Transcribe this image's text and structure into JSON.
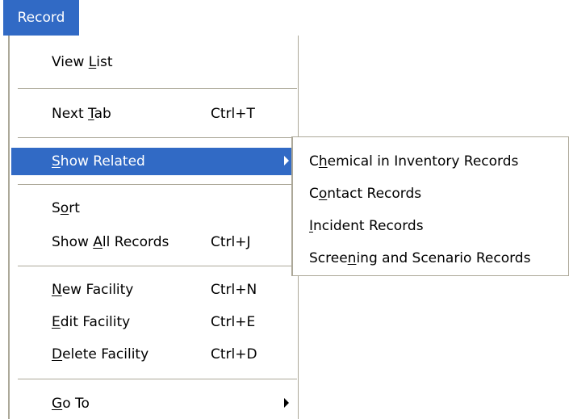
{
  "menubar": {
    "title": "Record"
  },
  "menu": {
    "view_list": {
      "pre": "View ",
      "key": "L",
      "post": "ist",
      "shortcut": ""
    },
    "next_tab": {
      "pre": "Next ",
      "key": "T",
      "post": "ab",
      "shortcut": "Ctrl+T"
    },
    "show_related": {
      "pre": "",
      "key": "S",
      "post": "how Related",
      "has_submenu": true
    },
    "sort": {
      "pre": "S",
      "key": "o",
      "post": "rt",
      "shortcut": ""
    },
    "show_all": {
      "pre": "Show ",
      "key": "A",
      "post": "ll Records",
      "shortcut": "Ctrl+J"
    },
    "new_facility": {
      "pre": "",
      "key": "N",
      "post": "ew Facility",
      "shortcut": "Ctrl+N"
    },
    "edit_facility": {
      "pre": "",
      "key": "E",
      "post": "dit Facility",
      "shortcut": "Ctrl+E"
    },
    "delete_facility": {
      "pre": "",
      "key": "D",
      "post": "elete Facility",
      "shortcut": "Ctrl+D"
    },
    "go_to": {
      "pre": "",
      "key": "G",
      "post": "o To",
      "has_submenu": true
    }
  },
  "submenu": {
    "chemical": {
      "pre": "C",
      "key": "h",
      "post": "emical in Inventory Records"
    },
    "contact": {
      "pre": "C",
      "key": "o",
      "post": "ntact Records"
    },
    "incident": {
      "pre": "",
      "key": "I",
      "post": "ncident Records"
    },
    "screening": {
      "pre": "Scree",
      "key": "n",
      "post": "ing and Scenario Records"
    }
  },
  "colors": {
    "highlight": "#316ac5",
    "border": "#aca899"
  }
}
